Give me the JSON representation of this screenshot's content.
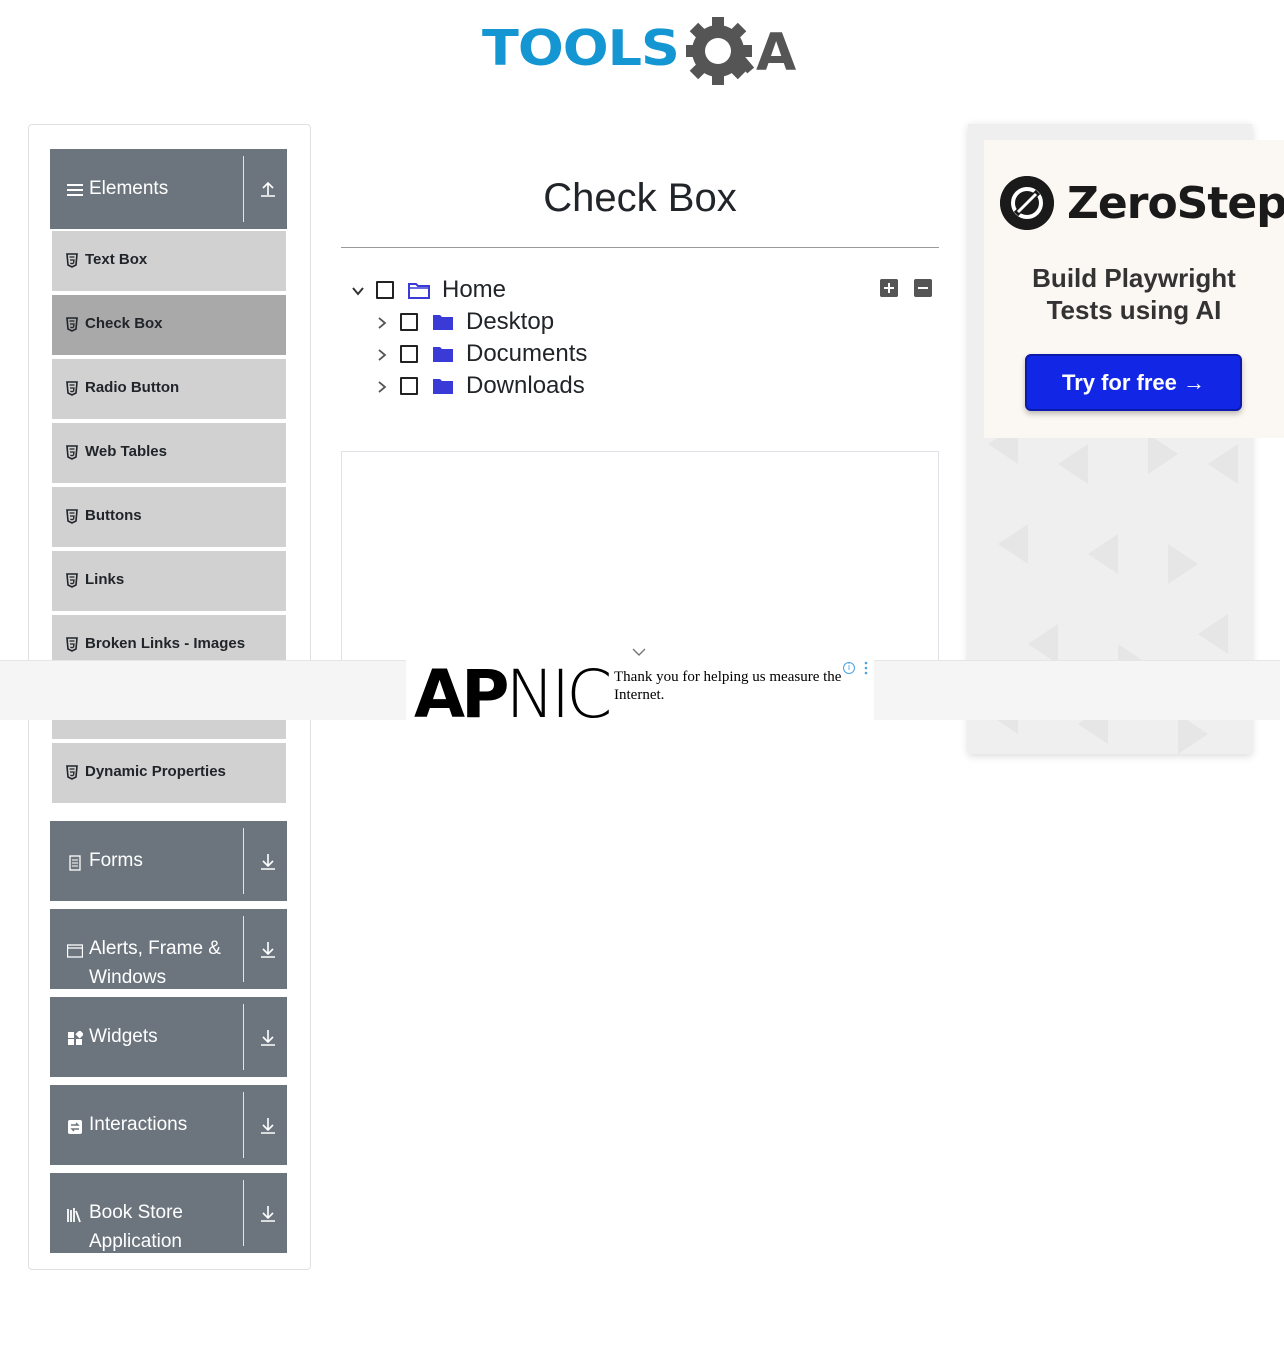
{
  "header": {
    "logo_text_primary": "TOOLS",
    "logo_text_secondary": "QA"
  },
  "sidebar": {
    "groups": [
      {
        "title": "Elements",
        "icon": "hamburger-icon",
        "state": "expanded"
      },
      {
        "title": "Forms",
        "icon": "form-icon",
        "state": "collapsed"
      },
      {
        "title": "Alerts, Frame &",
        "title2": "Windows",
        "icon": "window-icon",
        "state": "collapsed"
      },
      {
        "title": "Widgets",
        "icon": "widgets-icon",
        "state": "collapsed"
      },
      {
        "title": "Interactions",
        "icon": "interactions-icon",
        "state": "collapsed"
      },
      {
        "title": "Book Store",
        "title2": "Application",
        "icon": "books-icon",
        "state": "collapsed"
      }
    ],
    "elements_items": [
      {
        "label": "Text Box"
      },
      {
        "label": "Check Box",
        "active": true
      },
      {
        "label": "Radio Button"
      },
      {
        "label": "Web Tables"
      },
      {
        "label": "Buttons"
      },
      {
        "label": "Links"
      },
      {
        "label": "Broken Links - Images"
      },
      {
        "label": "Dynamic Properties"
      }
    ]
  },
  "main": {
    "title": "Check Box",
    "tree": [
      {
        "label": "Home",
        "expanded": true,
        "checked": false
      },
      {
        "label": "Desktop",
        "expanded": false,
        "checked": false
      },
      {
        "label": "Documents",
        "expanded": false,
        "checked": false
      },
      {
        "label": "Downloads",
        "expanded": false,
        "checked": false
      }
    ],
    "expand_all_icon": "plus-square-icon",
    "collapse_all_icon": "minus-square-icon"
  },
  "side_ad": {
    "brand": "ZeroStep",
    "tagline_line1": "Build Playwright",
    "tagline_line2": "Tests using AI",
    "cta": "Try for free →"
  },
  "banner_ad": {
    "brand_bold": "AP",
    "brand_light": "NIC",
    "message": "Thank you for helping us measure the Internet."
  },
  "colors": {
    "sidebar_header": "#6c757d",
    "menu_item": "#d1d1d1",
    "menu_item_active": "#a9a9a9",
    "folder_icon": "#3a3ad6",
    "logo_blue": "#1396d1",
    "cta_blue": "#1227e6"
  }
}
